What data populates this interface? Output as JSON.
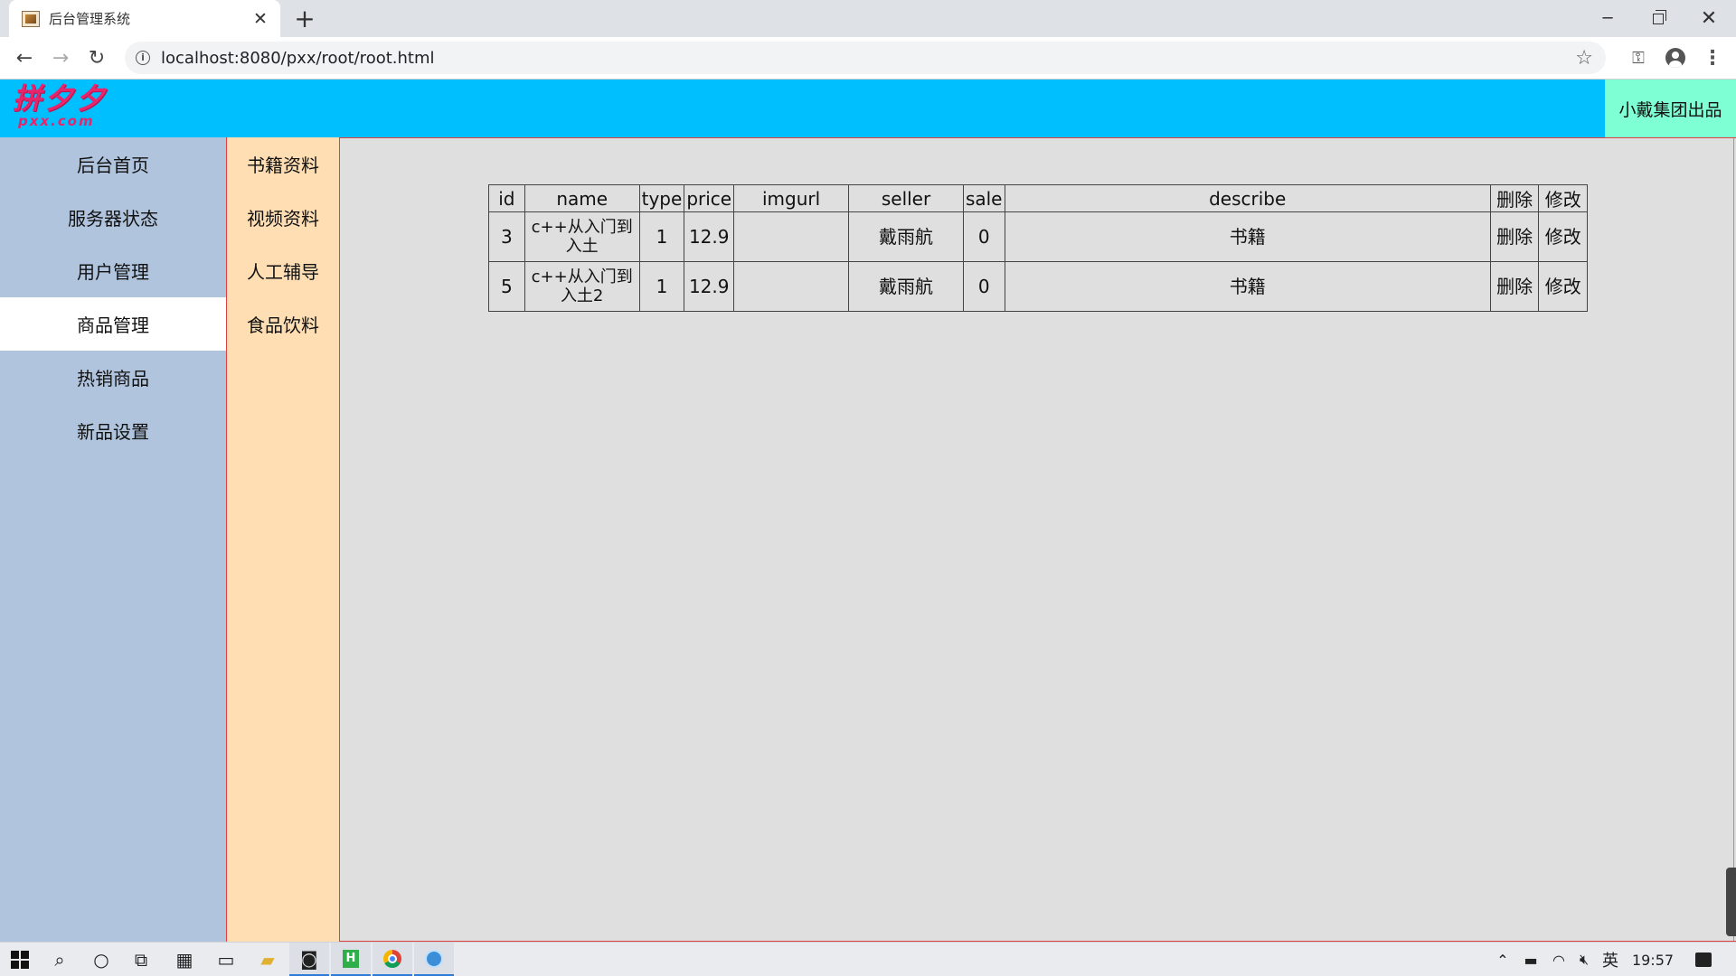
{
  "browser": {
    "tab_title": "后台管理系统",
    "tab_close": "✕",
    "new_tab": "+",
    "url": "localhost:8080/pxx/root/root.html"
  },
  "header": {
    "logo_main": "拼夕夕",
    "logo_sub": "pxx.com",
    "credit": "小戴集团出品",
    "bg_color": "#00bfff",
    "credit_bg": "#7fffd4"
  },
  "sidebar": {
    "items": [
      {
        "label": "后台首页"
      },
      {
        "label": "服务器状态"
      },
      {
        "label": "用户管理"
      },
      {
        "label": "商品管理"
      },
      {
        "label": "热销商品"
      },
      {
        "label": "新品设置"
      }
    ],
    "active": "商品管理",
    "bg_color": "#b0c4de"
  },
  "subnav": {
    "items": [
      {
        "label": "书籍资料"
      },
      {
        "label": "视频资料"
      },
      {
        "label": "人工辅导"
      },
      {
        "label": "食品饮料"
      }
    ],
    "bg_color": "#ffdeb4"
  },
  "table": {
    "columns": [
      "id",
      "name",
      "type",
      "price",
      "imgurl",
      "seller",
      "sale",
      "describe",
      "删除",
      "修改"
    ],
    "rows": [
      {
        "id": "3",
        "name": "c++从入门到入土",
        "type": "1",
        "price": "12.9",
        "imgurl": "",
        "seller": "戴雨航",
        "sale": "0",
        "describe": "书籍",
        "delete": "删除",
        "edit": "修改"
      },
      {
        "id": "5",
        "name": "c++从入门到入土2",
        "type": "1",
        "price": "12.9",
        "imgurl": "",
        "seller": "戴雨航",
        "sale": "0",
        "describe": "书籍",
        "delete": "删除",
        "edit": "修改"
      }
    ]
  },
  "taskbar": {
    "ime": "英",
    "time": "19:57"
  }
}
